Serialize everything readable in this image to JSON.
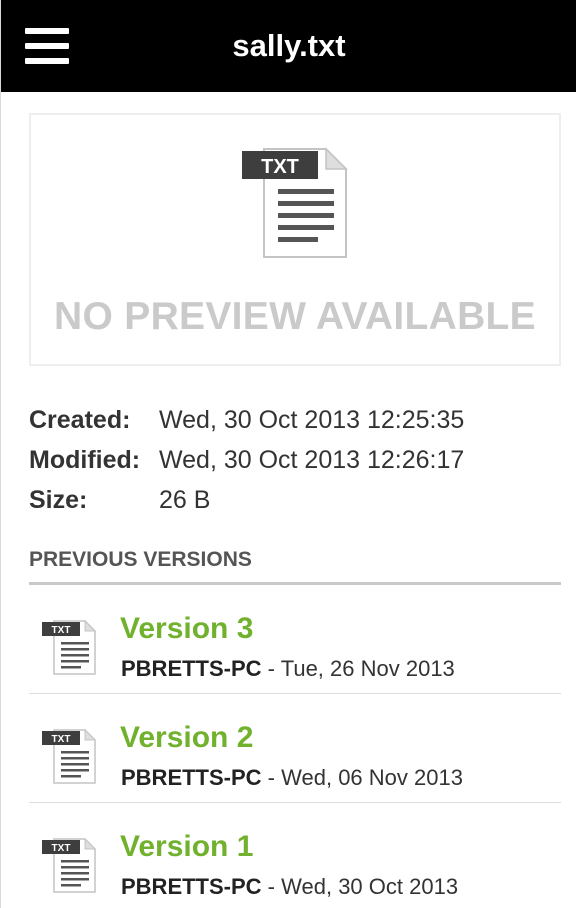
{
  "header": {
    "menu_icon": "hamburger-menu-icon",
    "title": "sally.txt"
  },
  "preview": {
    "file_icon": "txt-file-icon",
    "file_badge": "TXT",
    "message": "NO PREVIEW AVAILABLE"
  },
  "meta": {
    "created_label": "Created:",
    "created_value": "Wed, 30 Oct 2013 12:25:35",
    "modified_label": "Modified:",
    "modified_value": "Wed, 30 Oct 2013 12:26:17",
    "size_label": "Size:",
    "size_value": "26 B"
  },
  "versions": {
    "header": "PREVIOUS VERSIONS",
    "separator": " - ",
    "items": [
      {
        "name": "Version 3",
        "device": "PBRETTS-PC",
        "date": "Tue, 26 Nov 2013",
        "badge": "TXT"
      },
      {
        "name": "Version 2",
        "device": "PBRETTS-PC",
        "date": "Wed, 06 Nov 2013",
        "badge": "TXT"
      },
      {
        "name": "Version 1",
        "device": "PBRETTS-PC",
        "date": "Wed, 30 Oct 2013",
        "badge": "TXT"
      }
    ]
  },
  "colors": {
    "header_bg": "#000000",
    "accent_green": "#71b12e",
    "muted_text": "#cacaca"
  }
}
